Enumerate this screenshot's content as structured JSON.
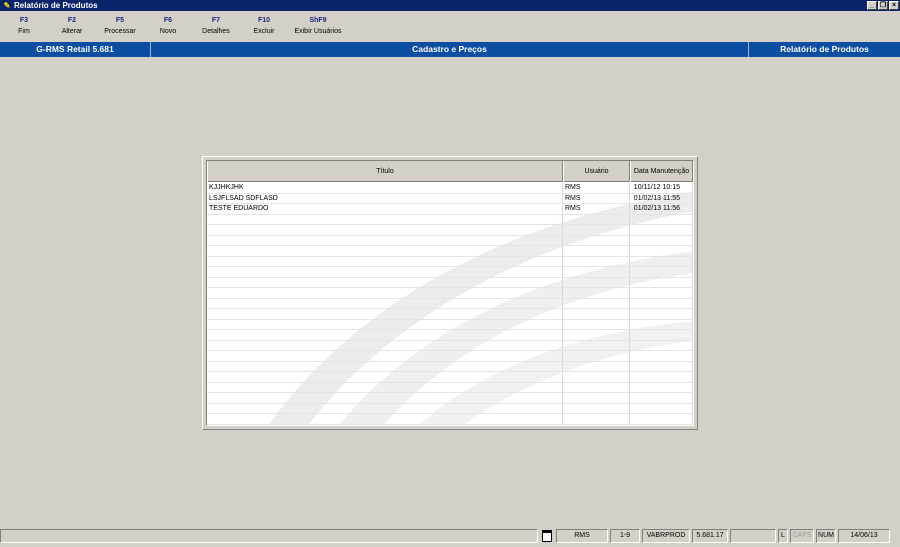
{
  "window": {
    "title": "Relatório de Produtos",
    "controls": {
      "minimize": "_",
      "restore": "❐",
      "close": "×"
    }
  },
  "toolbar": [
    {
      "key": "F3",
      "label": "Fim"
    },
    {
      "key": "F2",
      "label": "Alterar"
    },
    {
      "key": "F5",
      "label": "Processar"
    },
    {
      "key": "F6",
      "label": "Novo"
    },
    {
      "key": "F7",
      "label": "Detalhes"
    },
    {
      "key": "F10",
      "label": "Excluir"
    },
    {
      "key": "ShF9",
      "label": "Exibir Usuários"
    }
  ],
  "header": {
    "left": "G-RMS Retail 5.681",
    "center": "Cadastro e Preços",
    "right": "Relatório de Produtos"
  },
  "grid": {
    "columns": [
      "Título",
      "Usuário",
      "Data Manutenção"
    ],
    "rows": [
      {
        "titulo": "KJJHKJHK",
        "usuario": "RMS",
        "data": "10/11/12 10:15"
      },
      {
        "titulo": "LSJFLSAD SDFLASD",
        "usuario": "RMS",
        "data": "01/02/13 11:55"
      },
      {
        "titulo": "TESTE EDUARDO",
        "usuario": "RMS",
        "data": "01/02/13 11:56"
      }
    ]
  },
  "status": {
    "main": "",
    "icon": "page-icon",
    "user": "RMS",
    "range": "1-9",
    "program": "VABRPROD",
    "version": "5.681.17",
    "empty": "",
    "l": "L",
    "caps": "CAPS",
    "num": "NUM",
    "date": "14/06/13"
  },
  "colors": {
    "titlebar": "#0a246a",
    "header": "#0b4ea2",
    "background": "#d4d0c8",
    "fkey": "#1a237e"
  }
}
